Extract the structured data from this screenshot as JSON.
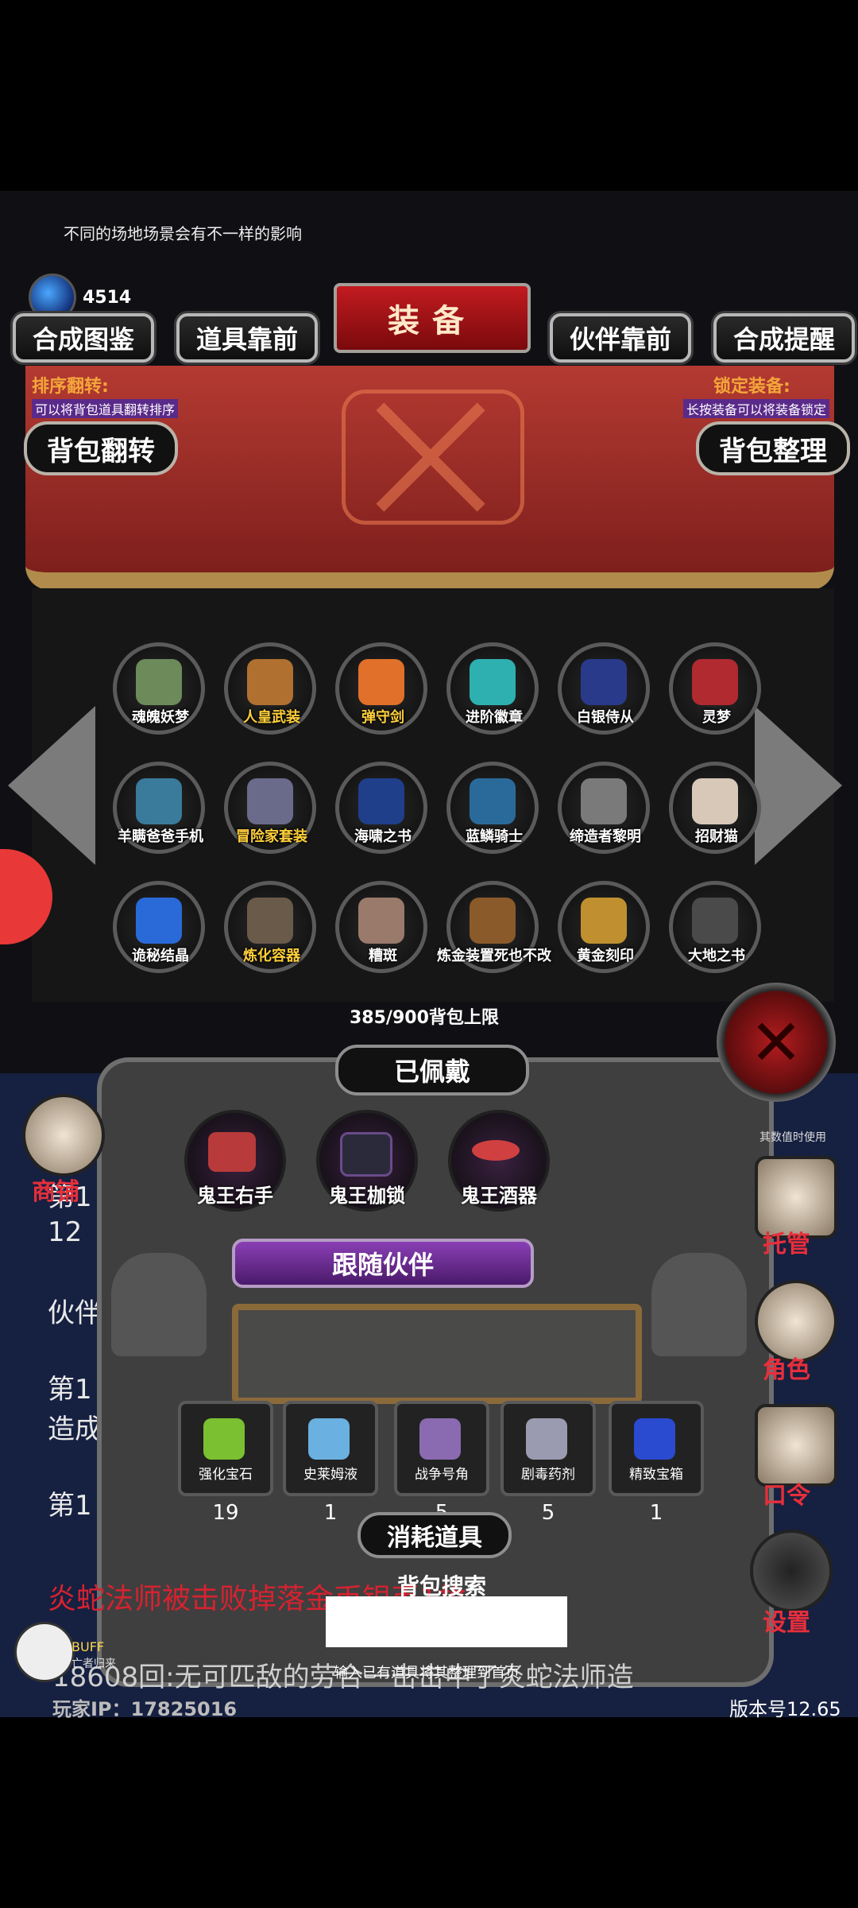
{
  "hint_text": "不同的场地场景会有不一样的影响",
  "currency": {
    "icon": "diamond-icon",
    "amount": "4514"
  },
  "tabs": {
    "synth_guide": "合成图鉴",
    "items_first": "道具靠前",
    "title": "装备",
    "partner_first": "伙伴靠前",
    "synth_remind": "合成提醒"
  },
  "sort": {
    "label": "排序翻转:",
    "desc": "可以将背包道具翻转排序",
    "button": "背包翻转"
  },
  "lock": {
    "label": "锁定装备:",
    "desc": "长按装备可以将装备锁定",
    "button": "背包整理"
  },
  "inventory": [
    {
      "name": "魂魄妖梦",
      "highlight": false,
      "color": "#6c8a5a"
    },
    {
      "name": "人皇武装",
      "highlight": true,
      "color": "#b07030"
    },
    {
      "name": "弹守剑",
      "highlight": true,
      "color": "#e0702a"
    },
    {
      "name": "进阶徽章",
      "highlight": false,
      "color": "#2fb0b0"
    },
    {
      "name": "白银侍从",
      "highlight": false,
      "color": "#2a3a8a"
    },
    {
      "name": "灵梦",
      "highlight": false,
      "color": "#b02a30"
    },
    {
      "name": "羊瞒爸爸手机",
      "highlight": false,
      "color": "#3a7a9a"
    },
    {
      "name": "冒险家套装",
      "highlight": true,
      "color": "#6a6a8a"
    },
    {
      "name": "海啸之书",
      "highlight": false,
      "color": "#1f3f8a"
    },
    {
      "name": "蓝鳞骑士",
      "highlight": false,
      "color": "#2a6a9a"
    },
    {
      "name": "缔造者黎明",
      "highlight": false,
      "color": "#7a7a7a"
    },
    {
      "name": "招财猫",
      "highlight": false,
      "color": "#d8c8b8"
    },
    {
      "name": "诡秘结晶",
      "highlight": false,
      "color": "#2a6ad8"
    },
    {
      "name": "炼化容器",
      "highlight": true,
      "color": "#6a5a4a"
    },
    {
      "name": "糟斑",
      "highlight": false,
      "color": "#9a7a6a"
    },
    {
      "name": "炼金装置死也不改",
      "highlight": false,
      "color": "#8a5a2a"
    },
    {
      "name": "黄金刻印",
      "highlight": false,
      "color": "#c09030"
    },
    {
      "name": "大地之书",
      "highlight": false,
      "color": "#4a4a4a"
    }
  ],
  "capacity": "385/900背包上限",
  "equipped": {
    "title": "已佩戴",
    "slots": [
      "鬼王右手",
      "鬼王枷锁",
      "鬼王酒器"
    ],
    "partner_title": "跟随伙伴",
    "consumables_title": "消耗道具",
    "consumables": [
      {
        "name": "强化宝石",
        "count": "19",
        "color": "#7ac030"
      },
      {
        "name": "史莱姆液",
        "count": "1",
        "color": "#6ab0e0"
      },
      {
        "name": "战争号角",
        "count": "5",
        "color": "#8a6ab0"
      },
      {
        "name": "剧毒药剂",
        "count": "5",
        "color": "#9a9ab0"
      },
      {
        "name": "精致宝箱",
        "count": "1",
        "color": "#2a4ad0"
      }
    ]
  },
  "side": {
    "shop": "商铺",
    "dice": "托管",
    "role": "角色",
    "command": "口令",
    "settings": "设置",
    "num_note": "其数值时使用"
  },
  "background_text": {
    "l1": "第1",
    "l2": "12",
    "l3": "伙伴",
    "l4": "第1",
    "l5": "造成",
    "l6": "第1"
  },
  "search": {
    "label": "背包搜索",
    "value": "",
    "hint": "输入已有道具将其整理到首页"
  },
  "log": {
    "kill": "炎蛇法师被击败掉落金币银币1枚",
    "round": "18608回:无可匹敌的劳合一击击中了炎蛇法师造"
  },
  "buff": {
    "label": "BUFF",
    "sub": "亡者归来"
  },
  "player_ip": "玩家IP：17825016",
  "version": "版本号12.65"
}
